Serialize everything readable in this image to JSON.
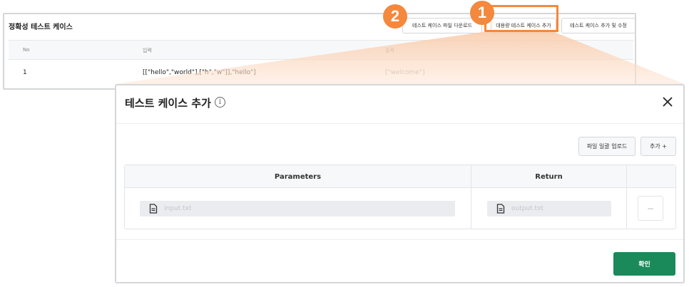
{
  "background_page": {
    "title": "정확성 테스트 케이스",
    "buttons": {
      "file_download": "테스트 케이스 파일 다운로드",
      "bulk_add": "대용량 테스트 케이스 추가",
      "add_edit": "테스트 케이스 추가 및 수정"
    },
    "table": {
      "headers": [
        "No",
        "입력",
        "출력"
      ],
      "rows": [
        {
          "no": "1",
          "input": "[[\"hello\",\"world\"],[\"h\",\"w\"]],\"hello\"]",
          "output": "[\"welcome\"]"
        }
      ]
    }
  },
  "steps": {
    "one": "1",
    "two": "2"
  },
  "colors": {
    "accent": "#f4883c",
    "confirm": "#1a8a5a",
    "border": "#d4d6d9"
  },
  "modal": {
    "title": "테스트 케이스 추가",
    "info_icon": "i",
    "close_icon": "close-icon",
    "upload_button": "파일 일괄 업로드",
    "add_button": "추가 +",
    "table": {
      "headers": {
        "params": "Parameters",
        "return": "Return"
      },
      "row": {
        "input_placeholder": "input.txt",
        "output_placeholder": "output.txt",
        "remove_label": "−"
      }
    },
    "confirm_button": "확인"
  }
}
